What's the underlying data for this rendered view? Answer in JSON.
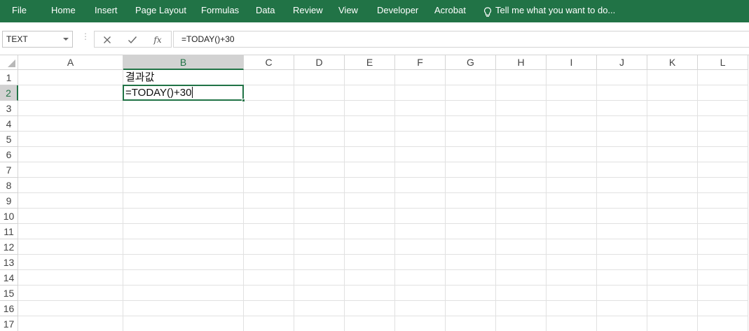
{
  "ribbon": {
    "tabs": [
      "File",
      "Home",
      "Insert",
      "Page Layout",
      "Formulas",
      "Data",
      "Review",
      "View",
      "Developer",
      "Acrobat"
    ],
    "tell_me": "Tell me what you want to do...",
    "bulb_icon": "lightbulb-icon",
    "color": "#217346"
  },
  "formula_bar": {
    "name_box": "TEXT",
    "cancel_icon": "close-icon",
    "enter_icon": "check-icon",
    "function_icon": "fx-icon",
    "function_label": "fx",
    "formula": "=TODAY()+30"
  },
  "grid": {
    "columns": [
      "A",
      "B",
      "C",
      "D",
      "E",
      "F",
      "G",
      "H",
      "I",
      "J",
      "K",
      "L"
    ],
    "rows": [
      "1",
      "2",
      "3",
      "4",
      "5",
      "6",
      "7",
      "8",
      "9",
      "10",
      "11",
      "12",
      "13",
      "14",
      "15",
      "16",
      "17"
    ],
    "selected_column": "B",
    "selected_row": "2",
    "cells": {
      "B1": "결과값",
      "B2": "=TODAY()+30"
    }
  }
}
